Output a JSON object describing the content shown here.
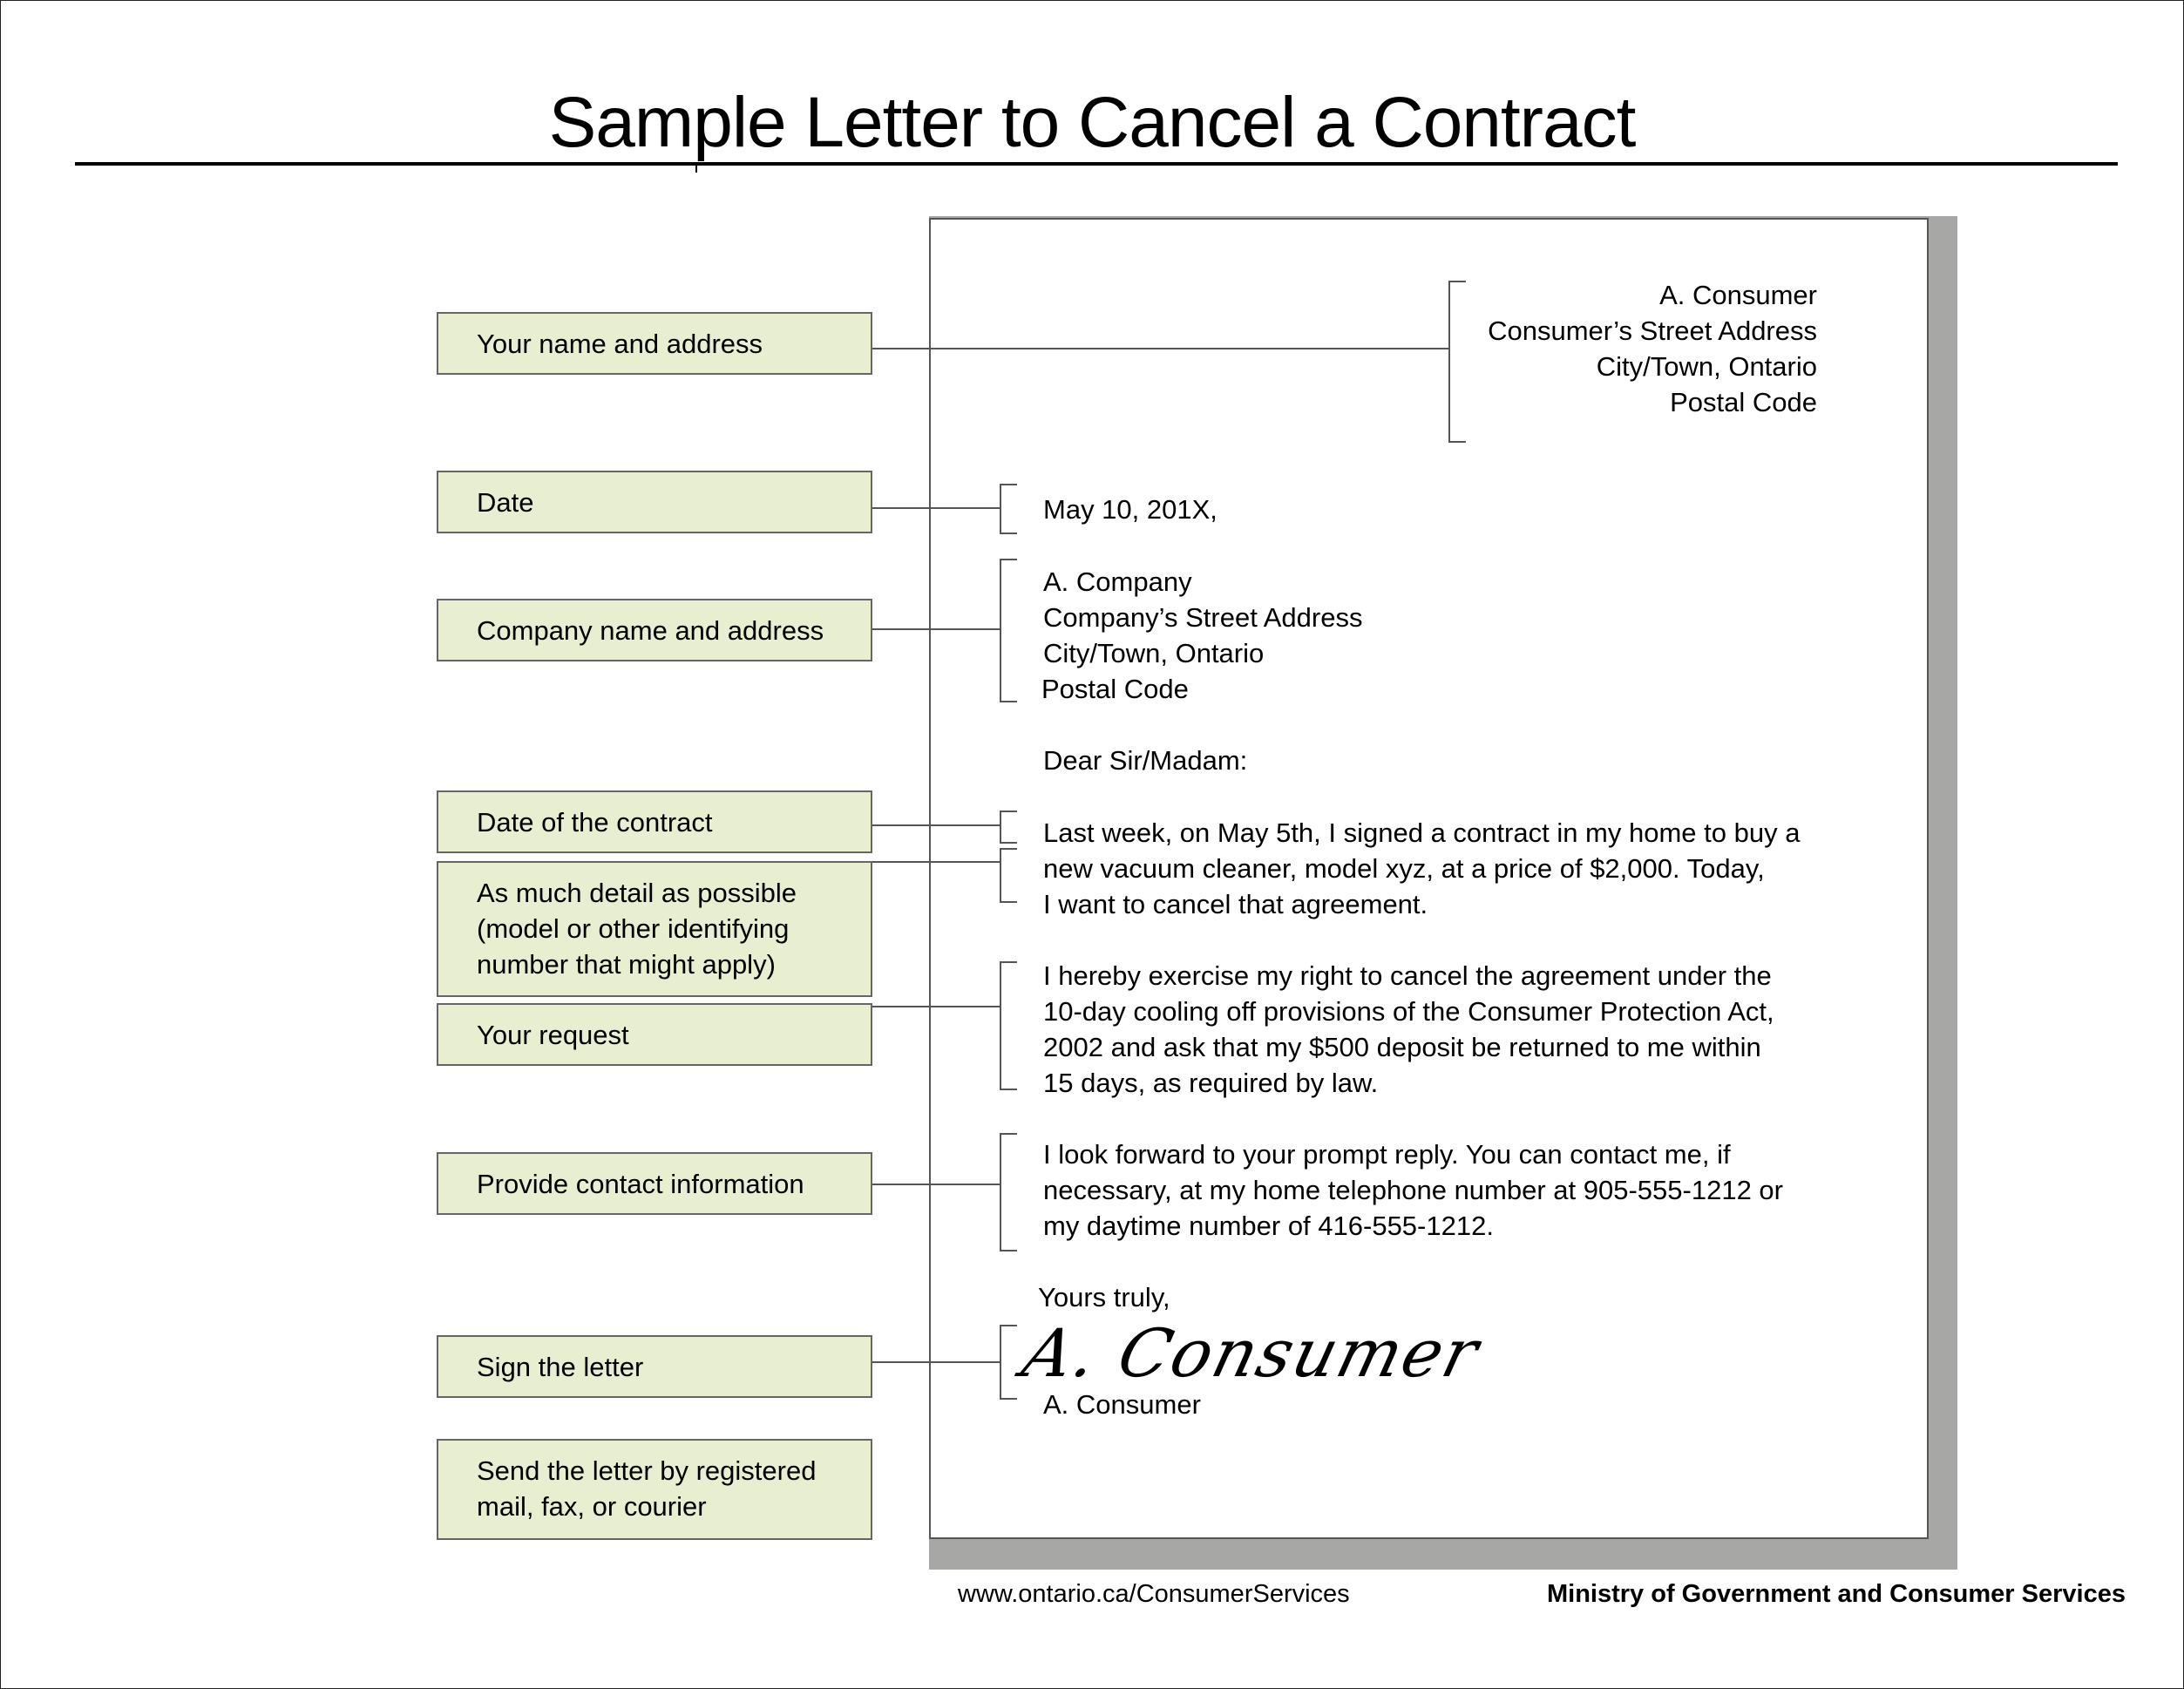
{
  "title": "Sample Letter to Cancel a Contract",
  "labels": [
    {
      "id": "your-name-and-address",
      "text": "Your name and address"
    },
    {
      "id": "date",
      "text": "Date"
    },
    {
      "id": "company-name-and-address",
      "text": "Company name and address"
    },
    {
      "id": "date-of-contract",
      "text": "Date of the contract"
    },
    {
      "id": "detail",
      "text": "As much detail as possible\n(model or other identifying\nnumber that might apply)"
    },
    {
      "id": "your-request",
      "text": "Your request"
    },
    {
      "id": "contact-info",
      "text": "Provide contact information"
    },
    {
      "id": "sign",
      "text": "Sign the letter"
    },
    {
      "id": "send",
      "text": "Send the letter by registered\nmail, fax, or courier"
    }
  ],
  "letter": {
    "sender": [
      "A. Consumer",
      "Consumer’s Street Address",
      "City/Town, Ontario",
      "Postal Code"
    ],
    "date": "May 10, 201X,",
    "recipient": [
      "A. Company",
      "Company’s Street Address",
      "City/Town, Ontario",
      "Postal Code"
    ],
    "salutation": "Dear Sir/Madam:",
    "paragraph1": [
      "Last week, on May 5th, I signed a contract in my home to buy a",
      "new vacuum cleaner, model xyz, at a price of $2,000. Today,",
      "I want to cancel that agreement."
    ],
    "paragraph2": [
      "I hereby exercise my right to cancel the agreement under the",
      "10-day cooling off provisions of the Consumer Protection Act,",
      "2002 and ask that my $500 deposit be returned to me within",
      "15 days, as required by law."
    ],
    "paragraph3": [
      "I look forward to your prompt reply. You can contact me, if",
      "necessary, at my home telephone number at 905-555-1212 or",
      "my daytime number of 416-555-1212."
    ],
    "closing": "Yours truly,",
    "signature": "A. Consumer",
    "printed_name": "A. Consumer"
  },
  "footer": {
    "url": "www.ontario.ca/ConsumerServices",
    "ministry": "Ministry of Government and Consumer Services"
  },
  "colors": {
    "label_fill": "#e8efd1",
    "label_border": "#666666",
    "page_shadow": "#a7a7a5"
  }
}
